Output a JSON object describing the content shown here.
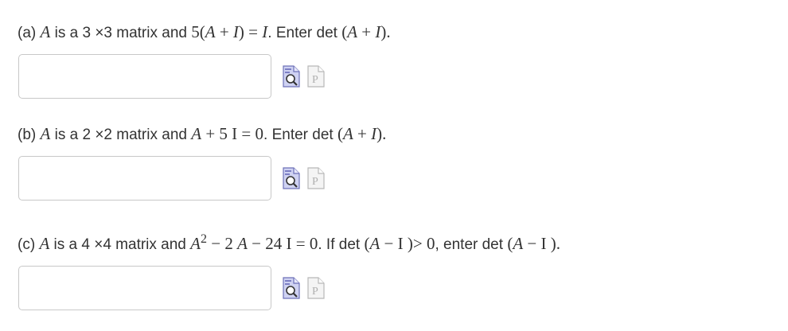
{
  "questions": [
    {
      "label": "(a)",
      "parts": [
        {
          "t": "A",
          "c": "m mi"
        },
        {
          "t": " is a 3 ×3 matrix and ",
          "c": "txt"
        },
        {
          "t": "5(",
          "c": "m"
        },
        {
          "t": "A",
          "c": "m mi"
        },
        {
          "t": " + ",
          "c": "m"
        },
        {
          "t": "I",
          "c": "m mi"
        },
        {
          "t": ") = ",
          "c": "m"
        },
        {
          "t": "I",
          "c": "m mi"
        },
        {
          "t": ". Enter det ",
          "c": "txt"
        },
        {
          "t": "(",
          "c": "m"
        },
        {
          "t": "A",
          "c": "m mi"
        },
        {
          "t": " + ",
          "c": "m"
        },
        {
          "t": "I",
          "c": "m mi"
        },
        {
          "t": ").",
          "c": "m"
        }
      ],
      "answer": ""
    },
    {
      "label": "(b)",
      "parts": [
        {
          "t": "A",
          "c": "m mi"
        },
        {
          "t": " is a 2 ×2 matrix and ",
          "c": "txt"
        },
        {
          "t": "A",
          "c": "m mi"
        },
        {
          "t": " + 5 I = 0",
          "c": "m"
        },
        {
          "t": ". Enter det ",
          "c": "txt"
        },
        {
          "t": "(",
          "c": "m"
        },
        {
          "t": "A",
          "c": "m mi"
        },
        {
          "t": " + ",
          "c": "m"
        },
        {
          "t": "I",
          "c": "m mi"
        },
        {
          "t": ").",
          "c": "m"
        }
      ],
      "answer": ""
    },
    {
      "label": "(c)",
      "parts": [
        {
          "t": "A",
          "c": "m mi"
        },
        {
          "t": " is a 4 ×4 matrix and ",
          "c": "txt"
        },
        {
          "t": "A",
          "c": "m mi"
        },
        {
          "t": "2",
          "c": "sup"
        },
        {
          "t": " − 2 ",
          "c": "m"
        },
        {
          "t": "A",
          "c": "m mi"
        },
        {
          "t": " − 24 I = 0",
          "c": "m"
        },
        {
          "t": ". If det ",
          "c": "txt"
        },
        {
          "t": "(",
          "c": "m"
        },
        {
          "t": "A",
          "c": "m mi"
        },
        {
          "t": " − I )> 0",
          "c": "m"
        },
        {
          "t": ", enter det ",
          "c": "txt"
        },
        {
          "t": "(",
          "c": "m"
        },
        {
          "t": "A",
          "c": "m mi"
        },
        {
          "t": " − I ).",
          "c": "m"
        }
      ],
      "answer": ""
    }
  ],
  "icons": {
    "preview": "preview-answer-icon",
    "help": "equation-help-icon"
  },
  "colors": {
    "text": "#333333",
    "input_border": "#c8c8c8",
    "preview_icon": "#7c7fc4",
    "help_icon": "#b8b8b8"
  }
}
